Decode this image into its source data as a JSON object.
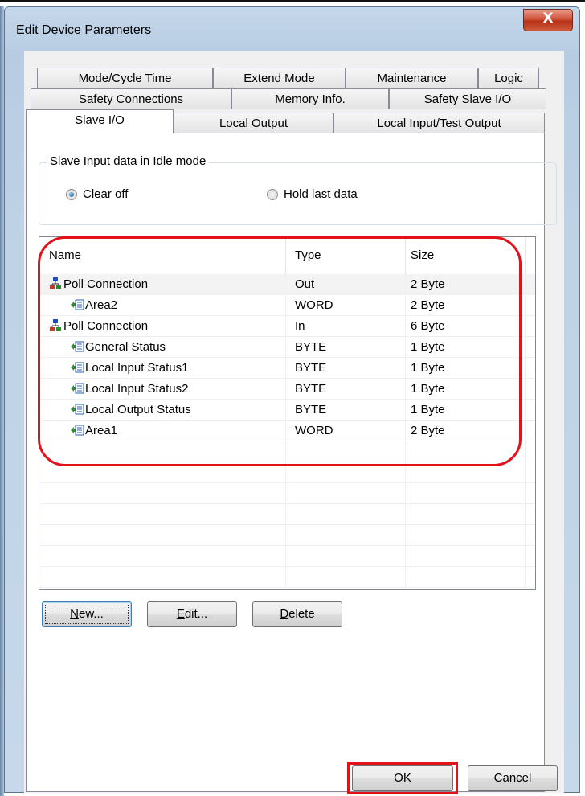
{
  "window": {
    "title": "Edit Device Parameters",
    "close_glyph": "X"
  },
  "tabs": {
    "row1": [
      "Mode/Cycle Time",
      "Extend Mode",
      "Maintenance",
      "Logic"
    ],
    "row2": [
      "Safety Connections",
      "Memory Info.",
      "Safety Slave I/O"
    ],
    "row3": [
      "Slave I/O",
      "Local Output",
      "Local Input/Test Output"
    ],
    "active": "Slave I/O"
  },
  "idle_mode": {
    "label": "Slave Input data in Idle mode",
    "options": [
      {
        "label": "Clear off",
        "selected": true
      },
      {
        "label": "Hold last data",
        "selected": false
      }
    ]
  },
  "table": {
    "columns": [
      "Name",
      "Type",
      "Size"
    ],
    "rows": [
      {
        "name": "Poll Connection",
        "type": "Out",
        "size": "2 Byte",
        "icon": "connection-icon",
        "level": 0
      },
      {
        "name": "Area2",
        "type": "WORD",
        "size": "2 Byte",
        "icon": "io-area-icon",
        "level": 1
      },
      {
        "name": "Poll Connection",
        "type": "In",
        "size": "6 Byte",
        "icon": "connection-icon",
        "level": 0
      },
      {
        "name": "General Status",
        "type": "BYTE",
        "size": "1 Byte",
        "icon": "io-area-icon",
        "level": 1
      },
      {
        "name": "Local Input Status1",
        "type": "BYTE",
        "size": "1 Byte",
        "icon": "io-area-icon",
        "level": 1
      },
      {
        "name": "Local Input Status2",
        "type": "BYTE",
        "size": "1 Byte",
        "icon": "io-area-icon",
        "level": 1
      },
      {
        "name": "Local Output Status",
        "type": "BYTE",
        "size": "1 Byte",
        "icon": "io-area-icon",
        "level": 1
      },
      {
        "name": "Area1",
        "type": "WORD",
        "size": "2 Byte",
        "icon": "io-area-icon",
        "level": 1
      }
    ]
  },
  "buttons": {
    "new_rest": "ew...",
    "new_key": "N",
    "edit_rest": "dit...",
    "edit_key": "E",
    "delete_rest": "elete",
    "delete_key": "D",
    "ok": "OK",
    "cancel": "Cancel"
  },
  "colors": {
    "highlight": "#e4111b",
    "window_frame": "#bfd2e6"
  }
}
